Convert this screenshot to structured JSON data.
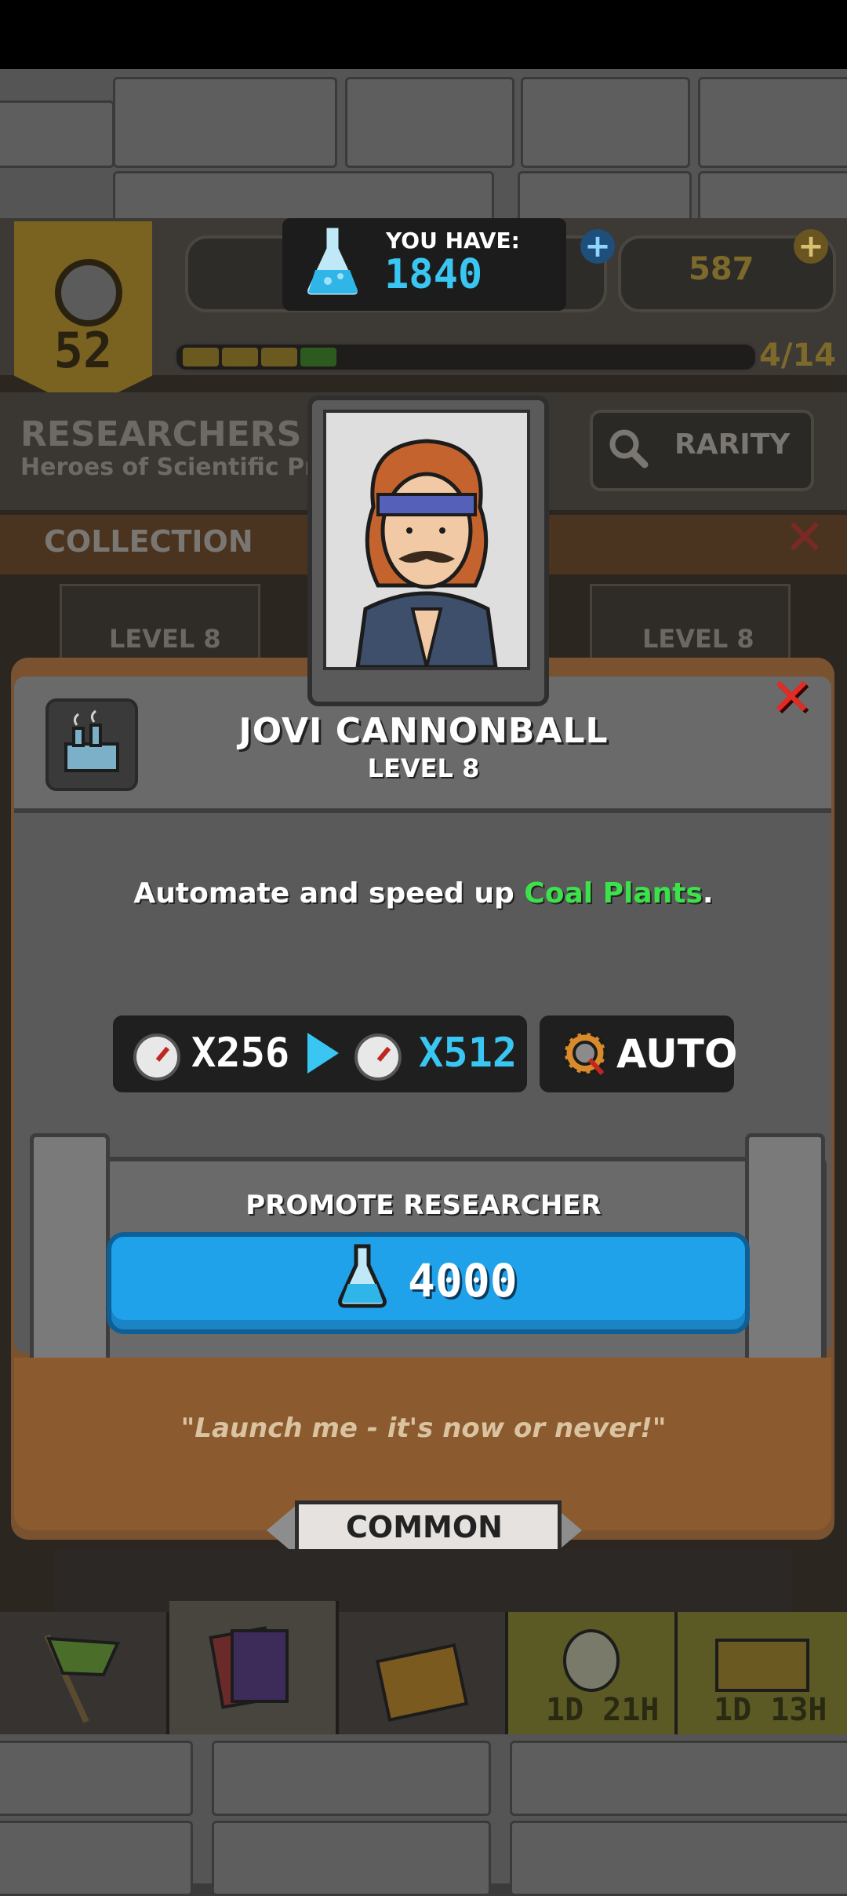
{
  "hud": {
    "you_have_label": "YOU HAVE:",
    "you_have_value": "1840",
    "player_level": "52",
    "resource_2": "587",
    "progress": "4/14"
  },
  "section": {
    "title": "RESEARCHERS",
    "subtitle": "Heroes of Scientific Prog",
    "rarity_button": "RARITY",
    "collection_tab": "COLLECTION",
    "card_level_left": "LEVEL 8",
    "card_level_right": "LEVEL 8"
  },
  "dialog": {
    "name": "JOVI CANNONBALL",
    "level": "LEVEL 8",
    "description_prefix": "Automate and speed up ",
    "description_highlight": "Coal Plants",
    "description_suffix": ".",
    "boost_from": "X256",
    "boost_to": "X512",
    "auto_label": "AUTO",
    "promote_label": "PROMOTE RESEARCHER",
    "promote_cost": "4000",
    "quote": "\"Launch me - it's now or never!\"",
    "rarity": "COMMON"
  },
  "nav": {
    "timer_1": "1D 21H",
    "timer_2": "1D 13H"
  },
  "colors": {
    "accent_blue": "#39c6f2",
    "highlight_green": "#3be24a",
    "close_red": "#e02c25"
  }
}
